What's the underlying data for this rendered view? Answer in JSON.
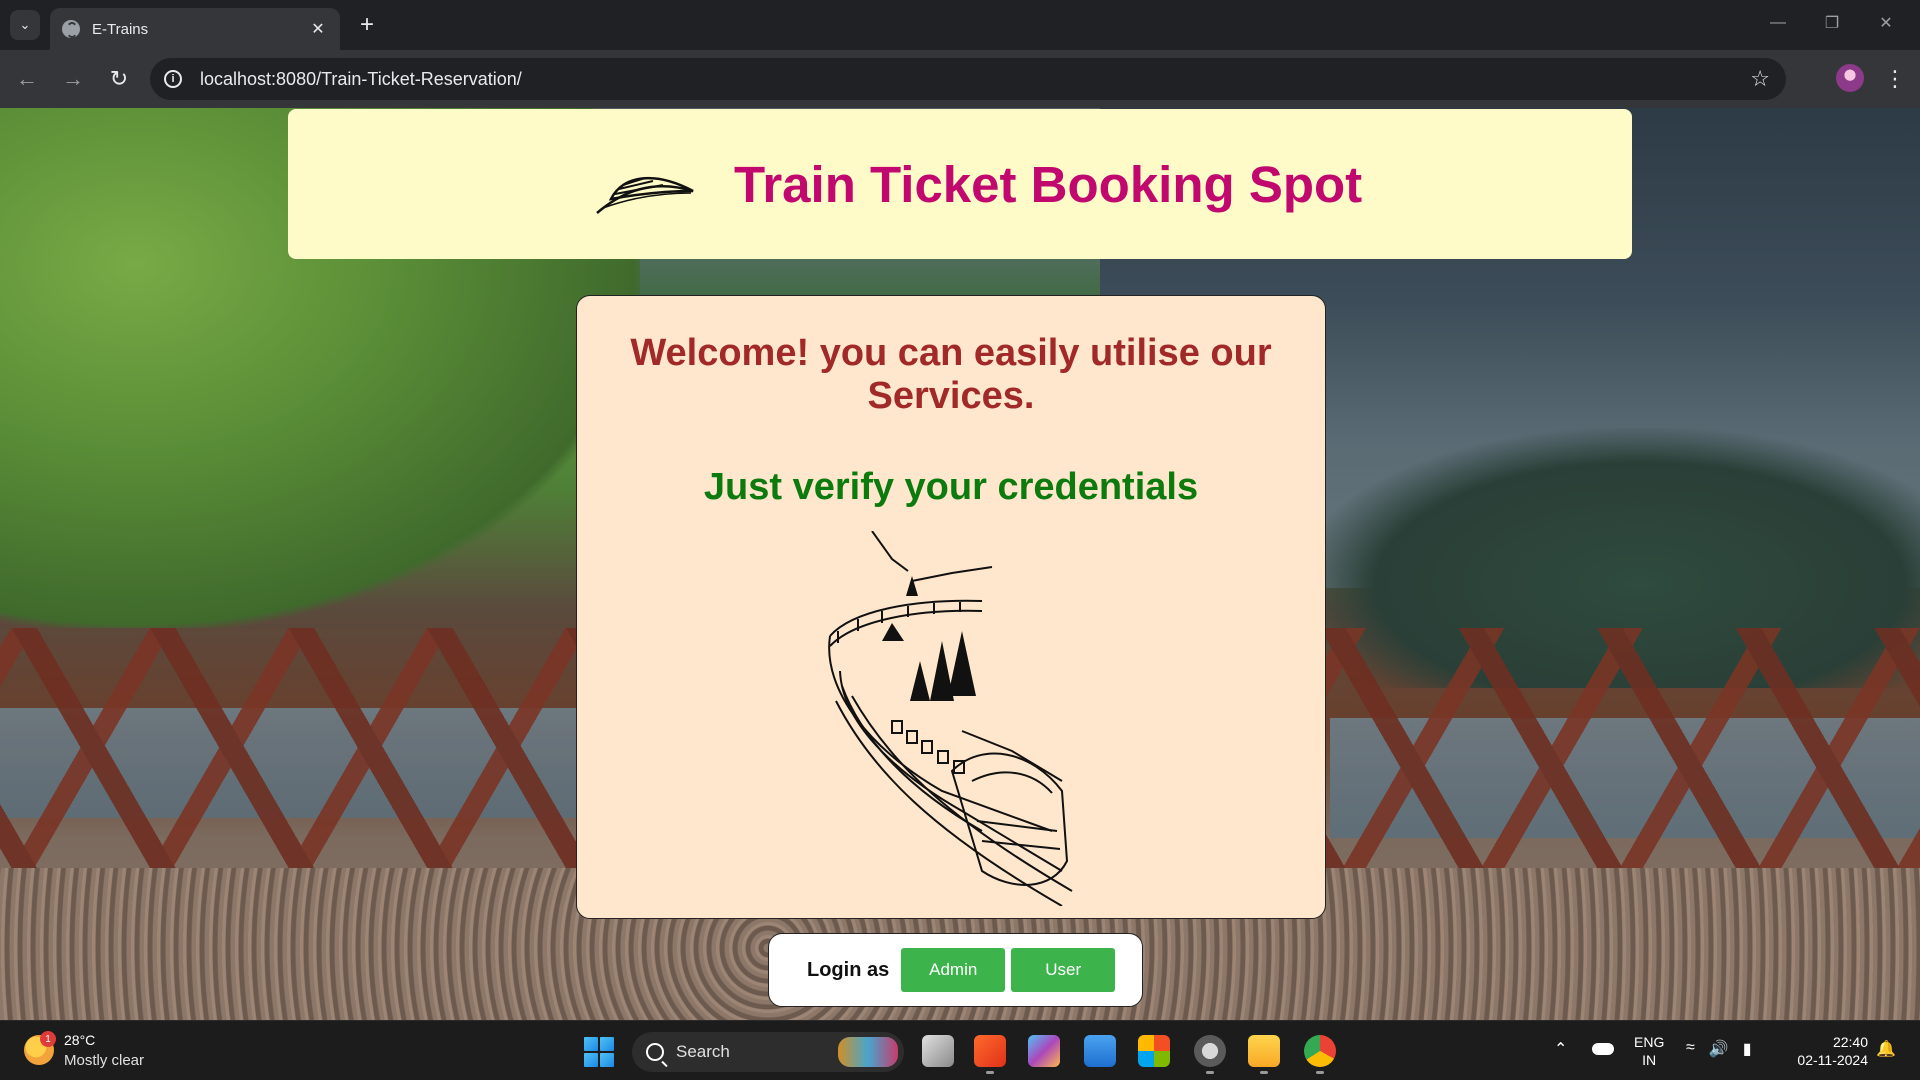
{
  "browser": {
    "tab_title": "E-Trains",
    "url": "localhost:8080/Train-Ticket-Reservation/"
  },
  "page": {
    "site_title": "Train Ticket Booking Spot",
    "welcome_text": "Welcome! you can easily utilise our Services.",
    "verify_text": "Just verify your credentials",
    "login": {
      "label": "Login as",
      "admin_button": "Admin",
      "user_button": "User"
    }
  },
  "colors": {
    "header_bg": "#fffbc8",
    "title": "#c0086f",
    "welcome": "#a12a28",
    "verify": "#0c7a0c",
    "button": "#3cb44b",
    "panel_bg": "#ffe7cd"
  },
  "taskbar": {
    "weather_temp": "28°C",
    "weather_desc": "Mostly clear",
    "weather_badge": "1",
    "search_label": "Search",
    "lang_line1": "ENG",
    "lang_line2": "IN",
    "time": "22:40",
    "date": "02-11-2024"
  },
  "icons": {
    "tab_search": "chevron-down-icon",
    "new_tab": "plus-icon",
    "back": "arrow-left-icon",
    "forward": "arrow-right-icon",
    "reload": "reload-icon",
    "site_info": "info-icon",
    "bookmark": "star-icon",
    "menu": "kebab-icon",
    "logo": "train-logo-icon"
  }
}
